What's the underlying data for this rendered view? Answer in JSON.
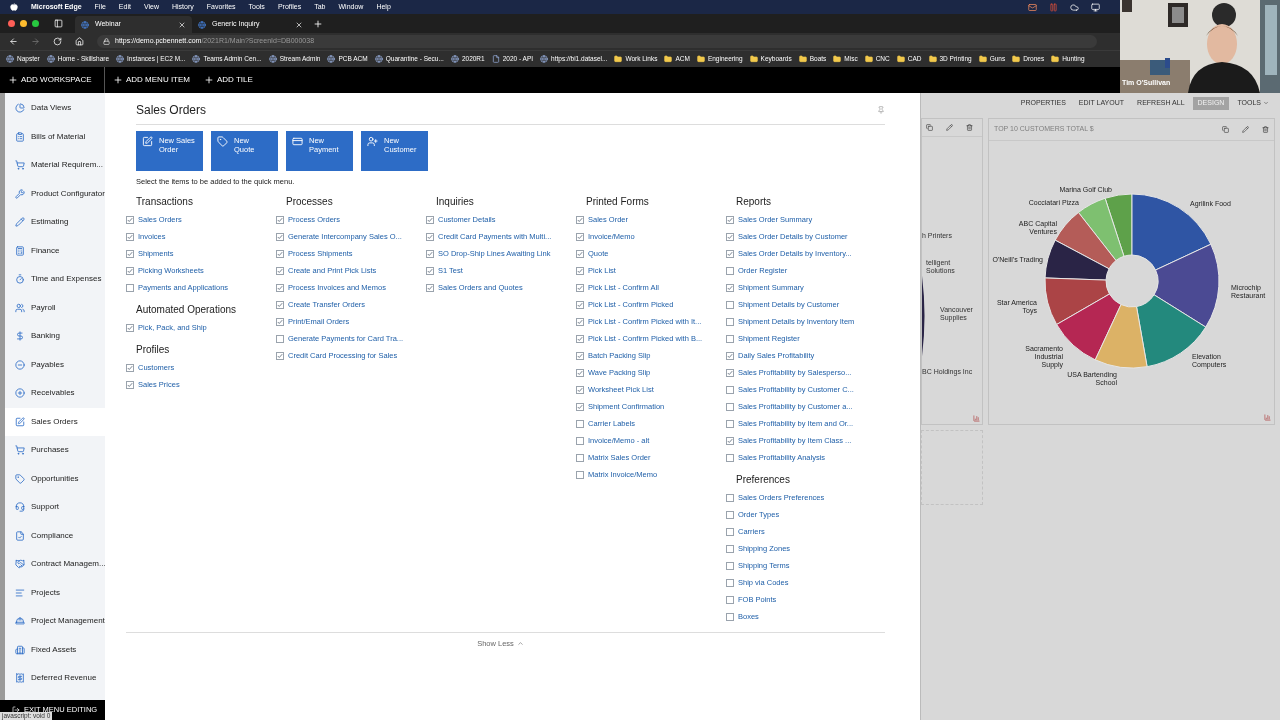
{
  "menu_bar": {
    "app": "Microsoft Edge",
    "items": [
      "File",
      "Edit",
      "View",
      "History",
      "Favorites",
      "Tools",
      "Profiles",
      "Tab",
      "Window",
      "Help"
    ]
  },
  "tabs": [
    {
      "label": "Webinar",
      "selected": true
    },
    {
      "label": "Generic Inquiry",
      "selected": false
    }
  ],
  "address": {
    "host": "https://demo.pcbennett.com",
    "path": "/2021R1/Main?ScreenId=DB000038"
  },
  "bookmarks": [
    {
      "label": "Napster",
      "kind": "site"
    },
    {
      "label": "Home - Skillshare",
      "kind": "site"
    },
    {
      "label": "Instances | EC2 M...",
      "kind": "site"
    },
    {
      "label": "Teams Admin Cen...",
      "kind": "site"
    },
    {
      "label": "Stream Admin",
      "kind": "site"
    },
    {
      "label": "PCB ACM",
      "kind": "site"
    },
    {
      "label": "Quarantine - Secu...",
      "kind": "site"
    },
    {
      "label": "2020R1",
      "kind": "site"
    },
    {
      "label": "2020 - API",
      "kind": "page"
    },
    {
      "label": "https://bi1.datasel...",
      "kind": "site"
    },
    {
      "label": "Work Links",
      "kind": "folder"
    },
    {
      "label": "ACM",
      "kind": "folder"
    },
    {
      "label": "Engineering",
      "kind": "folder"
    },
    {
      "label": "Keyboards",
      "kind": "folder"
    },
    {
      "label": "Boats",
      "kind": "folder"
    },
    {
      "label": "Misc",
      "kind": "folder"
    },
    {
      "label": "CNC",
      "kind": "folder"
    },
    {
      "label": "CAD",
      "kind": "folder"
    },
    {
      "label": "3D Printing",
      "kind": "folder"
    },
    {
      "label": "Guns",
      "kind": "folder"
    },
    {
      "label": "Drones",
      "kind": "folder"
    },
    {
      "label": "Hunting",
      "kind": "folder"
    }
  ],
  "webcam": {
    "kind": "picture",
    "name": "Tim O'Sullivan"
  },
  "app_bar": [
    "ADD WORKSPACE",
    "ADD MENU ITEM",
    "ADD TILE"
  ],
  "sidebar": {
    "items": [
      {
        "label": "Data Views",
        "selected": false
      },
      {
        "label": "Bills of Material",
        "selected": false
      },
      {
        "label": "Material Requirem...",
        "selected": false
      },
      {
        "label": "Product Configurator",
        "selected": false
      },
      {
        "label": "Estimating",
        "selected": false
      },
      {
        "label": "Finance",
        "selected": false
      },
      {
        "label": "Time and Expenses",
        "selected": false
      },
      {
        "label": "Payroll",
        "selected": false
      },
      {
        "label": "Banking",
        "selected": false
      },
      {
        "label": "Payables",
        "selected": false
      },
      {
        "label": "Receivables",
        "selected": false
      },
      {
        "label": "Sales Orders",
        "selected": true
      },
      {
        "label": "Purchases",
        "selected": false
      },
      {
        "label": "Opportunities",
        "selected": false
      },
      {
        "label": "Support",
        "selected": false
      },
      {
        "label": "Compliance",
        "selected": false
      },
      {
        "label": "Contract Managem...",
        "selected": false
      },
      {
        "label": "Projects",
        "selected": false
      },
      {
        "label": "Project Management",
        "selected": false
      },
      {
        "label": "Fixed Assets",
        "selected": false
      },
      {
        "label": "Deferred Revenue",
        "selected": false
      }
    ],
    "exit": "EXIT MENU EDITING"
  },
  "status_text": "javascript: void 0",
  "workspace": {
    "title": "Sales Orders",
    "tiles": [
      {
        "label": "New Sales Order"
      },
      {
        "label": "New Quote"
      },
      {
        "label": "New Payment"
      },
      {
        "label": "New Customer"
      }
    ],
    "hint": "Select the items to be added to the quick menu.",
    "columns": [
      {
        "groups": [
          {
            "title": "Transactions",
            "items": [
              {
                "label": "Sales Orders",
                "checked": true
              },
              {
                "label": "Invoices",
                "checked": true
              },
              {
                "label": "Shipments",
                "checked": true
              },
              {
                "label": "Picking Worksheets",
                "checked": true
              },
              {
                "label": "Payments and Applications",
                "checked": false
              }
            ]
          },
          {
            "title": "Automated Operations",
            "items": [
              {
                "label": "Pick, Pack, and Ship",
                "checked": true
              }
            ]
          },
          {
            "title": "Profiles",
            "items": [
              {
                "label": "Customers",
                "checked": true
              },
              {
                "label": "Sales Prices",
                "checked": true
              }
            ]
          }
        ]
      },
      {
        "groups": [
          {
            "title": "Processes",
            "items": [
              {
                "label": "Process Orders",
                "checked": true
              },
              {
                "label": "Generate Intercompany Sales O...",
                "checked": true
              },
              {
                "label": "Process Shipments",
                "checked": true
              },
              {
                "label": "Create and Print Pick Lists",
                "checked": true
              },
              {
                "label": "Process Invoices and Memos",
                "checked": true
              },
              {
                "label": "Create Transfer Orders",
                "checked": true
              },
              {
                "label": "Print/Email Orders",
                "checked": true
              },
              {
                "label": "Generate Payments for Card Tra...",
                "checked": false
              },
              {
                "label": "Credit Card Processing for Sales",
                "checked": true
              }
            ]
          }
        ]
      },
      {
        "groups": [
          {
            "title": "Inquiries",
            "items": [
              {
                "label": "Customer Details",
                "checked": true
              },
              {
                "label": "Credit Card Payments with Multi...",
                "checked": true
              },
              {
                "label": "SO Drop-Ship Lines Awaiting Link",
                "checked": true
              },
              {
                "label": "S1 Test",
                "checked": true
              },
              {
                "label": "Sales Orders and Quotes",
                "checked": true
              }
            ]
          }
        ]
      },
      {
        "groups": [
          {
            "title": "Printed Forms",
            "items": [
              {
                "label": "Sales Order",
                "checked": true
              },
              {
                "label": "Invoice/Memo",
                "checked": true
              },
              {
                "label": "Quote",
                "checked": true
              },
              {
                "label": "Pick List",
                "checked": true
              },
              {
                "label": "Pick List - Confirm All",
                "checked": true
              },
              {
                "label": "Pick List - Confirm Picked",
                "checked": true
              },
              {
                "label": "Pick List - Confirm Picked with It...",
                "checked": true
              },
              {
                "label": "Pick List - Confirm Picked with B...",
                "checked": true
              },
              {
                "label": "Batch Packing Slip",
                "checked": true
              },
              {
                "label": "Wave Packing Slip",
                "checked": true
              },
              {
                "label": "Worksheet Pick List",
                "checked": true
              },
              {
                "label": "Shipment Confirmation",
                "checked": true
              },
              {
                "label": "Carrier Labels",
                "checked": false
              },
              {
                "label": "Invoice/Memo - alt",
                "checked": false
              },
              {
                "label": "Matrix Sales Order",
                "checked": false
              },
              {
                "label": "Matrix Invoice/Memo",
                "checked": false
              }
            ]
          }
        ]
      },
      {
        "groups": [
          {
            "title": "Reports",
            "items": [
              {
                "label": "Sales Order Summary",
                "checked": true
              },
              {
                "label": "Sales Order Details by Customer",
                "checked": true
              },
              {
                "label": "Sales Order Details by Inventory...",
                "checked": true
              },
              {
                "label": "Order Register",
                "checked": false
              },
              {
                "label": "Shipment Summary",
                "checked": true
              },
              {
                "label": "Shipment Details by Customer",
                "checked": false
              },
              {
                "label": "Shipment Details by Inventory Item",
                "checked": false
              },
              {
                "label": "Shipment Register",
                "checked": false
              },
              {
                "label": "Daily Sales Profitability",
                "checked": true
              },
              {
                "label": "Sales Profitability by Salesperso...",
                "checked": true
              },
              {
                "label": "Sales Profitability by Customer C...",
                "checked": false
              },
              {
                "label": "Sales Profitability by Customer a...",
                "checked": false
              },
              {
                "label": "Sales Profitability by Item and Or...",
                "checked": false
              },
              {
                "label": "Sales Profitability by Item Class ...",
                "checked": true
              },
              {
                "label": "Sales Profitability Analysis",
                "checked": false
              }
            ]
          },
          {
            "title": "Preferences",
            "items": [
              {
                "label": "Sales Orders Preferences",
                "checked": false
              },
              {
                "label": "Order Types",
                "checked": false
              },
              {
                "label": "Carriers",
                "checked": false
              },
              {
                "label": "Shipping Zones",
                "checked": false
              },
              {
                "label": "Shipping Terms",
                "checked": false
              },
              {
                "label": "Ship via Codes",
                "checked": false
              },
              {
                "label": "FOB Points",
                "checked": false
              },
              {
                "label": "Boxes",
                "checked": false
              }
            ]
          }
        ]
      }
    ],
    "show_less": "Show Less"
  },
  "dashboard": {
    "toolbar": [
      {
        "label": "PROPERTIES",
        "selected": false
      },
      {
        "label": "EDIT LAYOUT",
        "selected": false
      },
      {
        "label": "REFRESH ALL",
        "selected": false
      },
      {
        "label": "DESIGN",
        "selected": true
      },
      {
        "label": "TOOLS",
        "selected": false
      }
    ],
    "partial_tile": {
      "labels": [
        "h Printers",
        "telligent Solutions",
        "Vancouver Supplies",
        "BC Holdings Inc"
      ]
    },
    "chart_tile": {
      "title": "TOP 10 CUSTOMERS TOTAL $",
      "slices": [
        {
          "label": "Marina Golf Club",
          "color": "#5ea14a"
        },
        {
          "label": "Cocciatari Pizza",
          "color": "#7ec070"
        },
        {
          "label": "Agrilink Food",
          "color": "#2f55a4"
        },
        {
          "label": "ABC Capital Ventures",
          "color": "#b45c58"
        },
        {
          "label": "O'Neill's Trading",
          "color": "#2a2446"
        },
        {
          "label": "Microchip Restaurant",
          "color": "#4b4a93"
        },
        {
          "label": "Star America Toys",
          "color": "#ab4446"
        },
        {
          "label": "Sacramento Industrial Supply",
          "color": "#b52753"
        },
        {
          "label": "Elevation Computers",
          "color": "#23897d"
        },
        {
          "label": "USA Bartending School",
          "color": "#dcb266"
        }
      ]
    }
  }
}
